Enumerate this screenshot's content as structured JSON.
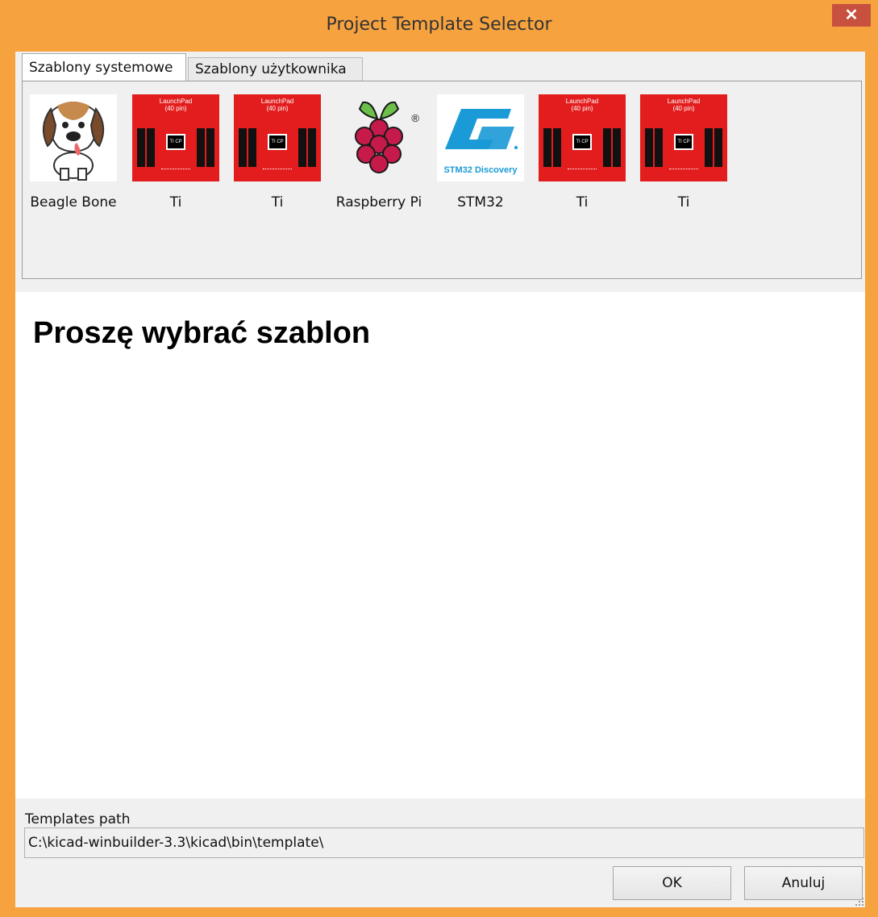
{
  "window": {
    "title": "Project Template Selector",
    "close_icon": "close-icon",
    "colors": {
      "frame": "#f6a23f",
      "close": "#c7503f"
    }
  },
  "tabs": [
    {
      "label": "Szablony systemowe",
      "active": true
    },
    {
      "label": "Szablony użytkownika",
      "active": false
    }
  ],
  "templates": [
    {
      "label": "Beagle Bone",
      "icon": "beaglebone-dog-icon"
    },
    {
      "label": "Ti",
      "icon": "ti-launchpad-icon",
      "thumb_text": "LaunchPad\n(40 pin)",
      "chip_text": "TI CP"
    },
    {
      "label": "Ti",
      "icon": "ti-launchpad-icon",
      "thumb_text": "LaunchPad\n(40 pin)",
      "chip_text": "TI CP"
    },
    {
      "label": "Raspberry Pi",
      "icon": "raspberry-pi-icon",
      "mark": "®"
    },
    {
      "label": "STM32",
      "icon": "stm32-logo-icon",
      "thumb_text": "STM32 Discovery"
    },
    {
      "label": "Ti",
      "icon": "ti-launchpad-icon",
      "thumb_text": "LaunchPad\n(40 pin)",
      "chip_text": "TI CP"
    },
    {
      "label": "Ti",
      "icon": "ti-launchpad-icon",
      "thumb_text": "LaunchPad\n(40 pin)",
      "chip_text": "TI CP"
    }
  ],
  "preview": {
    "heading": "Proszę wybrać szablon"
  },
  "path": {
    "label": "Templates path",
    "value": "C:\\kicad-winbuilder-3.3\\kicad\\bin\\template\\"
  },
  "buttons": {
    "ok": "OK",
    "cancel": "Anuluj"
  }
}
